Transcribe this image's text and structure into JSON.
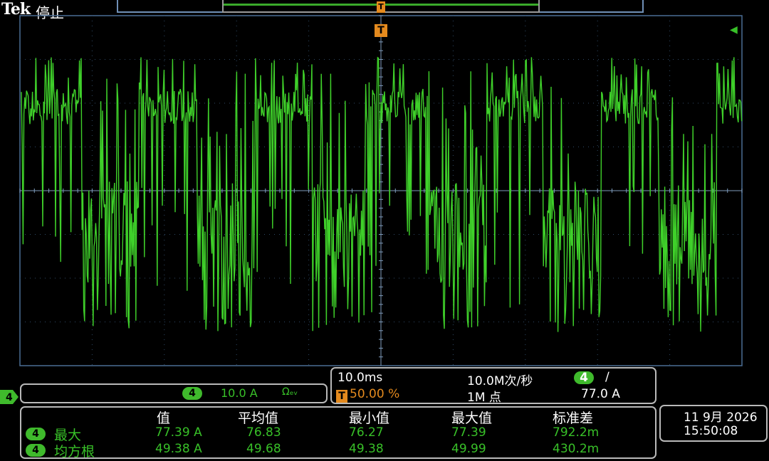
{
  "header": {
    "brand": "Tek",
    "state": "停止"
  },
  "markers": {
    "trigger_position": "T",
    "trigger_level_icon": "left-arrow-icon",
    "channel_marker": "4"
  },
  "scale_bar": {
    "channel": "4",
    "value": "10.0 A",
    "symbol": "Ωₑᵥ"
  },
  "horizontal": {
    "time_div": "10.0ms",
    "sample_rate": "10.0M次/秒",
    "trigger_badge": "T",
    "trigger_pos": "50.00 %",
    "points": "1M 点",
    "trigger_channel": "4",
    "trigger_slope": "∕",
    "trigger_level": "77.0 A"
  },
  "measurements": {
    "headers": [
      "值",
      "平均值",
      "最小值",
      "最大值",
      "标准差"
    ],
    "rows": [
      {
        "channel": "4",
        "label": "最大",
        "values": [
          "77.39 A",
          "76.83",
          "76.27",
          "77.39",
          "792.2m"
        ]
      },
      {
        "channel": "4",
        "label": "均方根",
        "values": [
          "49.38 A",
          "49.68",
          "49.38",
          "49.99",
          "430.2m"
        ]
      }
    ]
  },
  "datetime": {
    "date": "11 9月 2026",
    "time": "15:50:08"
  },
  "colors": {
    "trace": "#3fd02a",
    "trigger": "#e48a1e",
    "graticule": "#4a6d94",
    "background": "#000000"
  },
  "chart_data": {
    "type": "line",
    "series": [
      {
        "color": "#3fd02a"
      }
    ],
    "grid": true
  }
}
